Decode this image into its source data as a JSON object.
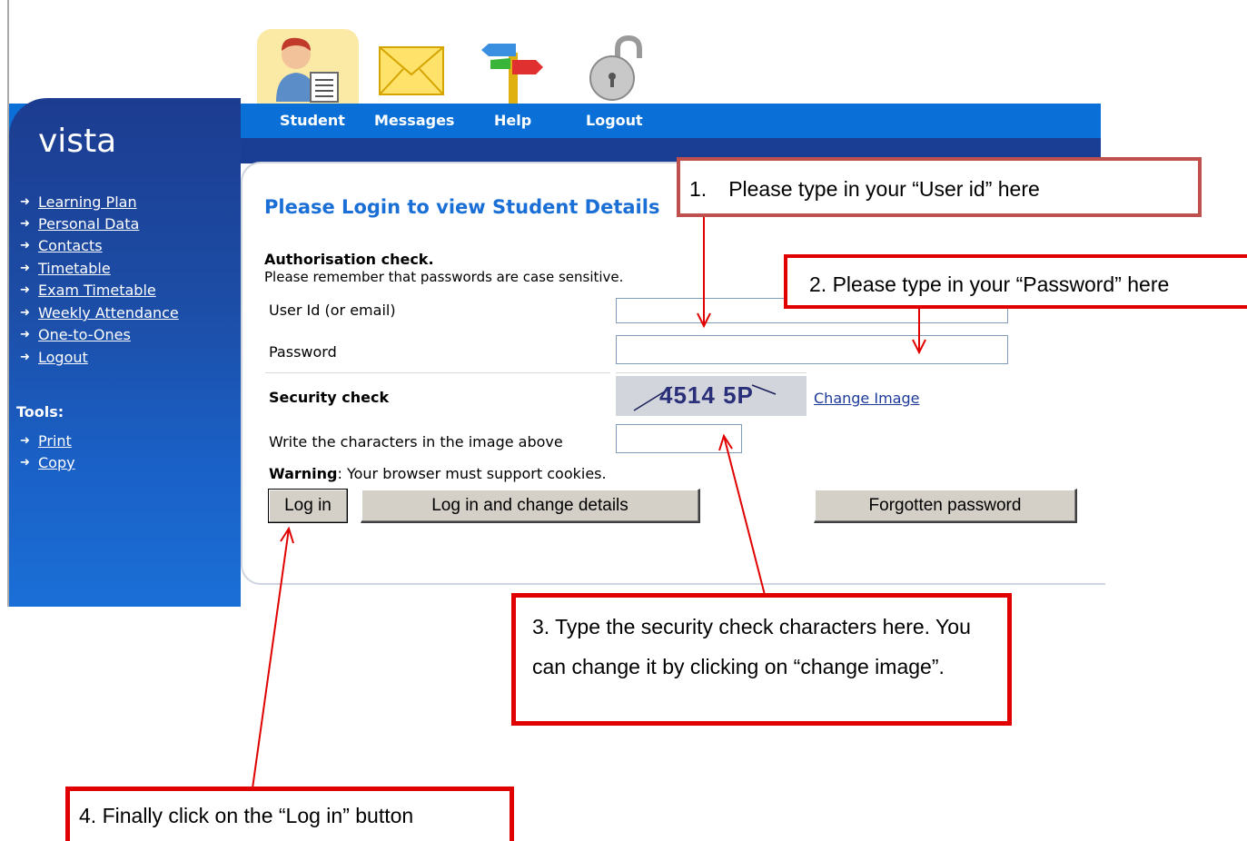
{
  "header": {
    "brand": "vista",
    "nav": [
      {
        "label": "Student",
        "icon": "student-icon"
      },
      {
        "label": "Messages",
        "icon": "envelope-icon"
      },
      {
        "label": "Help",
        "icon": "signpost-icon"
      },
      {
        "label": "Logout",
        "icon": "padlock-icon"
      }
    ]
  },
  "sidebar": {
    "items": [
      {
        "label": "Learning Plan"
      },
      {
        "label": "Personal Data"
      },
      {
        "label": "Contacts"
      },
      {
        "label": "Timetable"
      },
      {
        "label": "Exam Timetable"
      },
      {
        "label": "Weekly Attendance"
      },
      {
        "label": "One-to-Ones"
      },
      {
        "label": "Logout"
      }
    ],
    "tools_label": "Tools:",
    "tools": [
      {
        "label": "Print"
      },
      {
        "label": "Copy"
      }
    ]
  },
  "login": {
    "title": "Please Login to view Student Details",
    "auth_title": "Authorisation check.",
    "auth_note": "Please remember that passwords are case sensitive.",
    "userid_label": "User Id (or email)",
    "userid_value": "",
    "password_label": "Password",
    "password_value": "",
    "security_label": "Security check",
    "captcha_text": "4514 5P",
    "change_image": "Change Image",
    "captcha_input_label": "Write the characters in the image above",
    "captcha_input_value": "",
    "warning_label": "Warning",
    "warning_text": ": Your browser must support cookies.",
    "btn_login": "Log in",
    "btn_login_change": "Log in and change details",
    "btn_forgot": "Forgotten password"
  },
  "annotations": {
    "c1_num": "1.",
    "c1_text": "Please type in your “User id” here",
    "c2": "2. Please type in your “Password” here",
    "c3": "3. Type the security check characters here. You can change it by clicking on “change image”.",
    "c4": "4. Finally click on the “Log in” button"
  },
  "colors": {
    "header_blue": "#0a6fd6",
    "sidebar_dark": "#1c3c90",
    "title_blue": "#1a6fd6",
    "callout_red": "#e00000",
    "callout1_border": "#c0504d"
  }
}
